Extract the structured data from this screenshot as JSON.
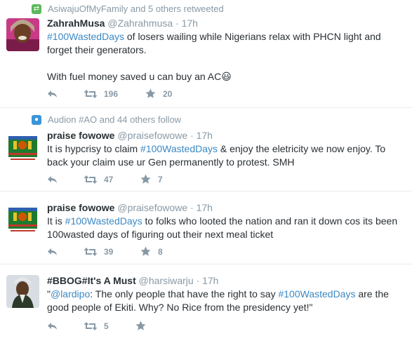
{
  "tweets": [
    {
      "context": "AsiwajuOfMyFamily and 5 others retweeted",
      "fullname": "ZahrahMusa",
      "handle": "@Zahrahmusa",
      "time": "· 17h",
      "text_hashtag": "#100WastedDays",
      "text_rest": " of losers wailing while Nigerians relax with PHCN light and forget their generators.",
      "text_p2": "With fuel money saved u can buy an AC",
      "emoji": "😃",
      "retweets": "196",
      "favorites": "20"
    },
    {
      "context": "Audion #AO and 44 others follow",
      "fullname": "praise fowowe",
      "handle": "@praisefowowe",
      "time": "· 17h",
      "text_pre": "It is hypcrisy to claim ",
      "text_hashtag": "#100WastedDays",
      "text_rest": " & enjoy the eletricity we now enjoy. To back your claim use ur Gen permanently to protest. SMH",
      "retweets": "47",
      "favorites": "7"
    },
    {
      "fullname": "praise fowowe",
      "handle": "@praisefowowe",
      "time": "· 17h",
      "text_pre": "It is ",
      "text_hashtag": "#100WastedDays",
      "text_rest": " to folks who looted the nation and ran it down cos its been 100wasted days of figuring out their next meal ticket",
      "retweets": "39",
      "favorites": "8"
    },
    {
      "fullname": "#BBOG#It's A Must",
      "handle": "@harsiwarju",
      "time": "· 17h",
      "text_q1": "\"",
      "text_mention": "@lardipo",
      "text_mid": ": The only people that have the right to say ",
      "text_hashtag": "#100WastedDays",
      "text_rest": " are the good people of Ekiti. Why? No Rice from the presidency yet!\"",
      "retweets": "5",
      "favorites": ""
    }
  ],
  "colors": {
    "link": "#3b88c3",
    "muted": "#8899a6",
    "retweet_context": "#5cb85c",
    "follow_context": "#3b94d9"
  },
  "icons": [
    "retweet-context-icon",
    "follow-context-icon",
    "reply-icon",
    "retweet-icon",
    "favorite-icon"
  ]
}
